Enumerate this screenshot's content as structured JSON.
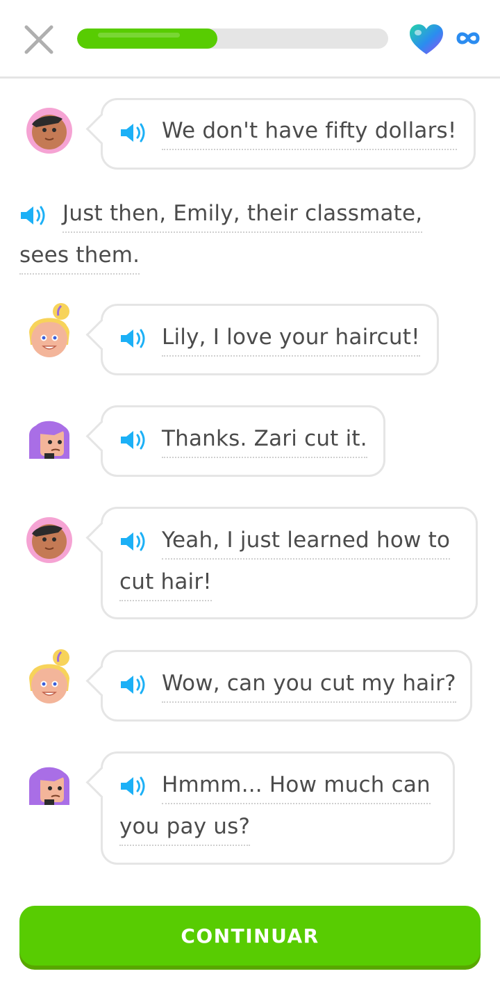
{
  "header": {
    "close_icon": "close-icon",
    "progress_fraction": 0.45,
    "hearts_icon": "heart-icon",
    "hearts_value": "infinite",
    "infinity_icon": "infinity-icon"
  },
  "colors": {
    "accent_green": "#58cc02",
    "accent_green_shadow": "#58a700",
    "speaker_blue": "#1cb0f6",
    "text": "#4b4b4b",
    "border": "#e5e5e5"
  },
  "dialogue": [
    {
      "speaker": "boy",
      "lines": [
        "We don't have fifty dollars!"
      ]
    },
    {
      "speaker": "narrator",
      "lines": [
        "Just then, Emily, their classmate,",
        "sees them."
      ]
    },
    {
      "speaker": "emily",
      "lines": [
        "Lily, I love your haircut!"
      ]
    },
    {
      "speaker": "lily",
      "lines": [
        "Thanks. Zari cut it."
      ]
    },
    {
      "speaker": "boy",
      "lines": [
        "Yeah, I just learned how to",
        "cut hair!"
      ]
    },
    {
      "speaker": "emily",
      "lines": [
        "Wow, can you cut my hair?"
      ]
    },
    {
      "speaker": "lily",
      "lines": [
        "Hmmm... How much can",
        "you pay us?"
      ]
    }
  ],
  "footer": {
    "continue_label": "CONTINUAR"
  }
}
